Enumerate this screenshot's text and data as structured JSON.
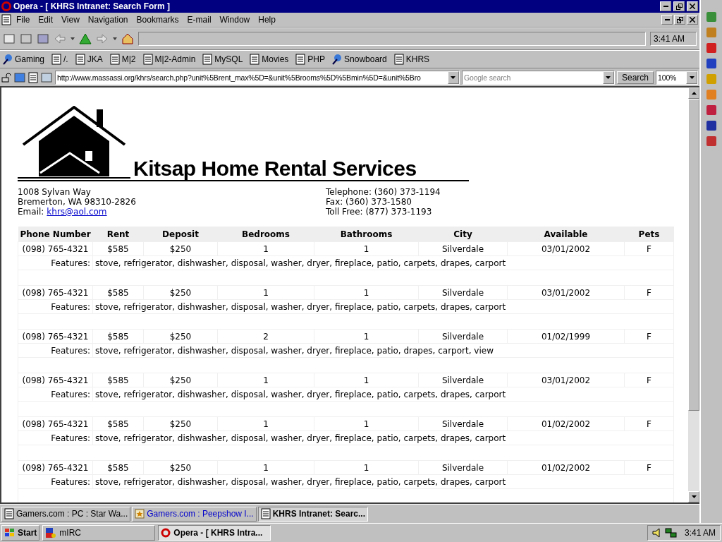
{
  "window": {
    "title": "Opera - [ KHRS Intranet: Search Form ]"
  },
  "menu": [
    "File",
    "Edit",
    "View",
    "Navigation",
    "Bookmarks",
    "E-mail",
    "Window",
    "Help"
  ],
  "toolbar": {
    "time": "3:41 AM"
  },
  "bookmarks": [
    {
      "label": "Gaming",
      "kind": "link"
    },
    {
      "label": "/.",
      "kind": "page"
    },
    {
      "label": "JKA",
      "kind": "page"
    },
    {
      "label": "M|2",
      "kind": "page"
    },
    {
      "label": "M|2-Admin",
      "kind": "page"
    },
    {
      "label": "MySQL",
      "kind": "page"
    },
    {
      "label": "Movies",
      "kind": "page"
    },
    {
      "label": "PHP",
      "kind": "page"
    },
    {
      "label": "Snowboard",
      "kind": "link"
    },
    {
      "label": "KHRS",
      "kind": "page"
    }
  ],
  "address": {
    "url": "http://www.massassi.org/khrs/search.php?unit%5Brent_max%5D=&unit%5Brooms%5D%5Bmin%5D=&unit%5Bro",
    "search_placeholder": "Google search",
    "search_button": "Search",
    "zoom": "100%"
  },
  "page": {
    "company": "Kitsap Home Rental Services",
    "address_lines": [
      "1008 Sylvan Way",
      "Bremerton, WA 98310-2826"
    ],
    "email_label": "Email:",
    "email": "khrs@aol.com",
    "contact_lines": [
      "Telephone: (360) 373-1194",
      "Fax: (360) 373-1580",
      "Toll Free: (877) 373-1193"
    ],
    "columns": [
      "Phone Number",
      "Rent",
      "Deposit",
      "Bedrooms",
      "Bathrooms",
      "City",
      "Available",
      "Pets"
    ],
    "listings": [
      {
        "cells": [
          "(098) 765-4321",
          "$585",
          "$250",
          "1",
          "1",
          "Silverdale",
          "03/01/2002",
          "F"
        ],
        "features_label": "Features:",
        "features": "stove, refrigerator, dishwasher, disposal, washer, dryer, fireplace, patio, carpets, drapes, carport"
      },
      {
        "cells": [
          "(098) 765-4321",
          "$585",
          "$250",
          "1",
          "1",
          "Silverdale",
          "03/01/2002",
          "F"
        ],
        "features_label": "Features:",
        "features": "stove, refrigerator, dishwasher, disposal, washer, dryer, fireplace, patio, carpets, drapes, carport"
      },
      {
        "cells": [
          "(098) 765-4321",
          "$585",
          "$250",
          "2",
          "1",
          "Silverdale",
          "01/02/1999",
          "F"
        ],
        "features_label": "Features:",
        "features": "stove, refrigerator, dishwasher, disposal, washer, dryer, fireplace, patio, drapes, carport, view"
      },
      {
        "cells": [
          "(098) 765-4321",
          "$585",
          "$250",
          "1",
          "1",
          "Silverdale",
          "03/01/2002",
          "F"
        ],
        "features_label": "Features:",
        "features": "stove, refrigerator, dishwasher, disposal, washer, dryer, fireplace, patio, carpets, drapes, carport"
      },
      {
        "cells": [
          "(098) 765-4321",
          "$585",
          "$250",
          "1",
          "1",
          "Silverdale",
          "01/02/2002",
          "F"
        ],
        "features_label": "Features:",
        "features": "stove, refrigerator, dishwasher, disposal, washer, dryer, fireplace, patio, carpets, drapes, carport"
      },
      {
        "cells": [
          "(098) 765-4321",
          "$585",
          "$250",
          "1",
          "1",
          "Silverdale",
          "01/02/2002",
          "F"
        ],
        "features_label": "Features:",
        "features": "stove, refrigerator, dishwasher, disposal, washer, dryer, fireplace, patio, carpets, drapes, carport"
      }
    ]
  },
  "page_tabs": [
    {
      "label": "Gamers.com : PC : Star Wa...",
      "kind": "page",
      "selected": false
    },
    {
      "label": "Gamers.com : Peepshow I...",
      "kind": "loading",
      "selected": false
    },
    {
      "label": "KHRS Intranet: Searc...",
      "kind": "page",
      "selected": true
    }
  ],
  "taskbar": {
    "start": "Start",
    "tasks": [
      {
        "label": "mIRC",
        "kind": "irc",
        "selected": false
      },
      {
        "label": "Opera - [ KHRS Intra...",
        "kind": "opera",
        "selected": true
      }
    ],
    "clock": "3:41 AM"
  }
}
